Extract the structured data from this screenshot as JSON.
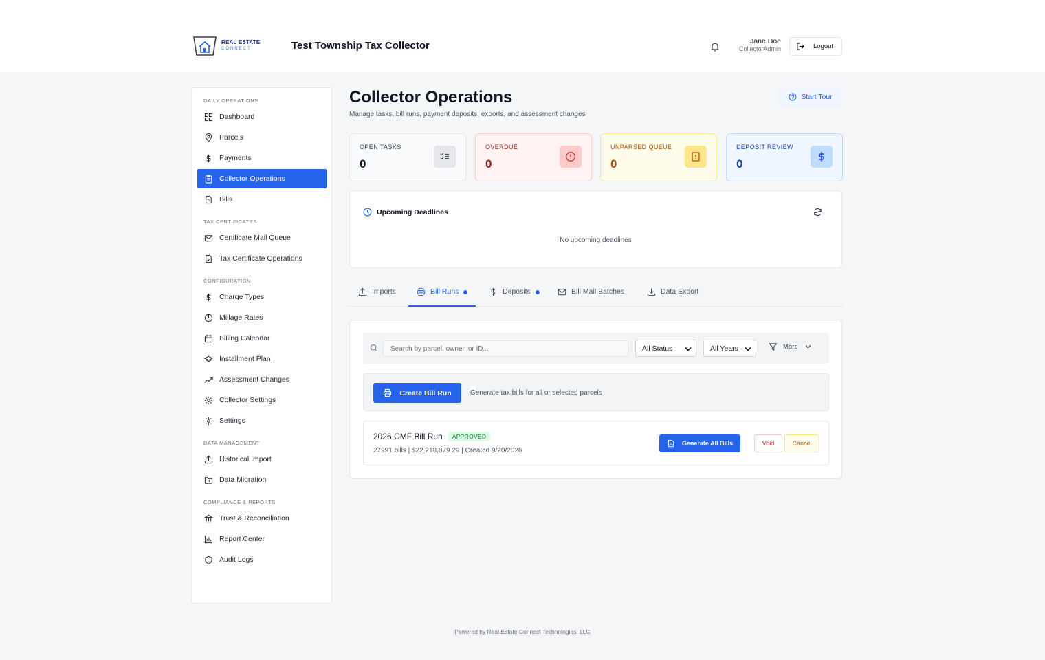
{
  "header": {
    "logo_line1": "REAL ESTATE",
    "logo_line2": "CONNECT",
    "app_title": "Test Township Tax Collector",
    "user_name": "Jane Doe",
    "user_role": "CollectorAdmin",
    "logout_label": "Logout"
  },
  "sidebar": {
    "sections": [
      {
        "title": "DAILY OPERATIONS",
        "items": [
          "Dashboard",
          "Parcels",
          "Payments",
          "Collector Operations",
          "Bills"
        ]
      },
      {
        "title": "TAX CERTIFICATES",
        "items": [
          "Certificate Mail Queue",
          "Tax Certificate Operations"
        ]
      },
      {
        "title": "CONFIGURATION",
        "items": [
          "Charge Types",
          "Millage Rates",
          "Billing Calendar",
          "Installment Plan",
          "Assessment Changes",
          "Collector Settings",
          "Settings"
        ]
      },
      {
        "title": "DATA MANAGEMENT",
        "items": [
          "Historical Import",
          "Data Migration"
        ]
      },
      {
        "title": "COMPLIANCE & REPORTS",
        "items": [
          "Trust & Reconciliation",
          "Report Center",
          "Audit Logs"
        ]
      }
    ],
    "active_item": "Collector Operations"
  },
  "main": {
    "title": "Collector Operations",
    "subtitle": "Manage tasks, bill runs, payment deposits, exports, and assessment changes",
    "tour_label": "Start Tour",
    "stats": [
      {
        "label": "OPEN TASKS",
        "value": "0"
      },
      {
        "label": "OVERDUE",
        "value": "0"
      },
      {
        "label": "UNPARSED QUEUE",
        "value": "0"
      },
      {
        "label": "DEPOSIT REVIEW",
        "value": "0"
      }
    ],
    "deadlines": {
      "title": "Upcoming Deadlines",
      "empty": "No upcoming deadlines"
    },
    "tabs": [
      "Imports",
      "Bill Runs",
      "Deposits",
      "Bill Mail Batches",
      "Data Export"
    ],
    "active_tab": "Bill Runs",
    "filters": {
      "search_placeholder": "Search by parcel, owner, or ID...",
      "status_value": "All Status",
      "years_value": "All Years",
      "more_label": "More"
    },
    "create": {
      "button_label": "Create Bill Run",
      "hint": "Generate tax bills for all or selected parcels"
    },
    "bill_run": {
      "name": "2026 CMF Bill Run",
      "status": "APPROVED",
      "meta": "27991 bills | $22,218,879.29  | Created 9/20/2026",
      "generate_label": "Generate All Bills",
      "void_label": "Void",
      "cancel_label": "Cancel"
    }
  },
  "footer": {
    "text": "Powered by Real Estate Connect Technologies, LLC"
  },
  "colors": {
    "accent": "#2563eb",
    "overdue": "#991b1b",
    "unparsed": "#b45309",
    "deposit": "#1e40af",
    "approved": "#15803d"
  }
}
